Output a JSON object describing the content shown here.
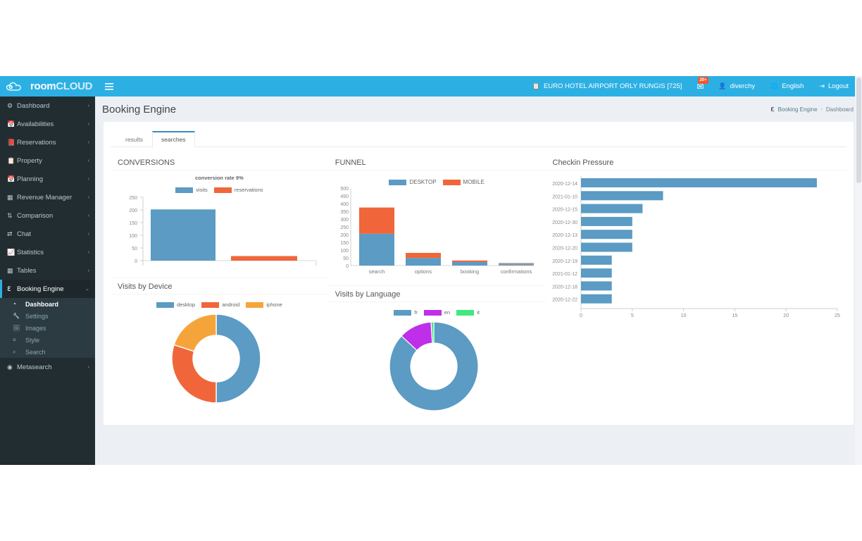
{
  "brand": {
    "room": "room",
    "cloud": "CLOUD",
    "logo_icon": "cloud-icon"
  },
  "topbar": {
    "hotel": "EURO HOTEL AIRPORT ORLY RUNGIS [725]",
    "hotel_icon": "clipboard-icon",
    "mail_icon": "envelope-icon",
    "mail_badge": "20+",
    "user": "diverchy",
    "user_icon": "user-icon",
    "language": "English",
    "language_icon": "globe-icon",
    "logout": "Logout",
    "logout_icon": "logout-icon",
    "bg_color": "#2cb0e4"
  },
  "sidebar": {
    "items": [
      {
        "label": "Dashboard",
        "icon": "gear-icon",
        "glyph": "⚙",
        "arrow": "‹"
      },
      {
        "label": "Availabilities",
        "icon": "calendar-icon",
        "glyph": "Ὄ5",
        "arrow": "‹"
      },
      {
        "label": "Reservations",
        "icon": "book-icon",
        "glyph": "▤",
        "arrow": "‹"
      },
      {
        "label": "Property",
        "icon": "clipboard-icon",
        "glyph": "ὌB",
        "arrow": "‹"
      },
      {
        "label": "Planning",
        "icon": "calendar-icon",
        "glyph": "Ὄ5",
        "arrow": "‹"
      },
      {
        "label": "Revenue Manager",
        "icon": "grid-icon",
        "glyph": "▦",
        "arrow": "‹"
      },
      {
        "label": "Comparison",
        "icon": "sort-icon",
        "glyph": "↓↑",
        "arrow": "‹"
      },
      {
        "label": "Chat",
        "icon": "exchange-icon",
        "glyph": "⇄",
        "arrow": "‹"
      },
      {
        "label": "Statistics",
        "icon": "chart-icon",
        "glyph": "ὌA",
        "arrow": "‹"
      },
      {
        "label": "Tables",
        "icon": "table-icon",
        "glyph": "▦",
        "arrow": "‹"
      },
      {
        "label": "Booking Engine",
        "icon": "booking-engine-icon",
        "glyph": "e",
        "arrow": "⌄",
        "active": true
      }
    ],
    "subitems": [
      {
        "label": "Dashboard",
        "icon": "dashboard-icon",
        "glyph": "◔",
        "active": true
      },
      {
        "label": "Settings",
        "icon": "wrench-icon",
        "glyph": "ὒ7",
        "active": false
      },
      {
        "label": "Images",
        "icon": "image-icon",
        "glyph": "ὛC",
        "active": false
      },
      {
        "label": "Style",
        "icon": "list-icon",
        "glyph": "≡",
        "active": false
      },
      {
        "label": "Search",
        "icon": "search-icon",
        "glyph": "⌕",
        "active": false
      }
    ],
    "footer_item": {
      "label": "Metasearch",
      "icon": "target-icon",
      "glyph": "◉",
      "arrow": "‹"
    },
    "bg_color": "#222d32"
  },
  "header": {
    "page_title": "Booking Engine",
    "breadcrumb_icon": "booking-engine-icon",
    "breadcrumb_root": "Booking Engine",
    "breadcrumb_sep": "›",
    "breadcrumb_current": "Dashboard"
  },
  "tabs": [
    {
      "label": "results",
      "active": false
    },
    {
      "label": "searches",
      "active": true
    }
  ],
  "colors": {
    "blue": "#5b9bc4",
    "orange": "#f0663a",
    "amber": "#f5a43a",
    "magenta": "#bf2ee8",
    "green": "#3ee97e",
    "gray": "#8c9aa5"
  },
  "chart_data": [
    {
      "id": "conversions",
      "type": "bar",
      "title": "CONVERSIONS",
      "subtitle": "conversion rate 9%",
      "categories": [
        "visits",
        "reservations"
      ],
      "values": [
        202,
        18
      ],
      "colors": [
        "#5b9bc4",
        "#f0663a"
      ],
      "legend": [
        "visits",
        "reservations"
      ],
      "legend_position": "top",
      "xlabel": "",
      "ylabel": "",
      "ylim": [
        0,
        250
      ],
      "yticks": [
        0,
        50,
        100,
        150,
        200,
        250
      ],
      "grid": false
    },
    {
      "id": "funnel",
      "type": "bar",
      "title": "FUNNEL",
      "subtitle": "",
      "stacked": true,
      "categories": [
        "search",
        "options",
        "booking",
        "confirmations"
      ],
      "series": [
        {
          "name": "DESKTOP",
          "values": [
            250,
            60,
            28,
            15
          ],
          "color": "#5b9bc4"
        },
        {
          "name": "MOBILE",
          "values": [
            210,
            40,
            12,
            0
          ],
          "color": "#f0663a"
        }
      ],
      "legend": [
        "DESKTOP",
        "MOBILE"
      ],
      "legend_position": "top",
      "xlabel": "",
      "ylabel": "",
      "ylim": [
        0,
        500
      ],
      "yticks": [
        0,
        50,
        100,
        150,
        200,
        250,
        300,
        350,
        400,
        450,
        500
      ],
      "grid": false,
      "note": "confirmations bar rendered in hover gray"
    },
    {
      "id": "checkin-pressure",
      "type": "bar",
      "orientation": "horizontal",
      "title": "Checkin Pressure",
      "categories": [
        "2020-12-14",
        "2021-01-10",
        "2020-12-15",
        "2020-12-30",
        "2020-12-13",
        "2020-12-20",
        "2020-12-19",
        "2021-01-12",
        "2020-12-18",
        "2020-12-22"
      ],
      "values": [
        23,
        8,
        6,
        5,
        5,
        5,
        3,
        3,
        3,
        3
      ],
      "color": "#5b9bc4",
      "xlabel": "",
      "ylabel": "",
      "xlim": [
        0,
        25
      ],
      "xticks": [
        0,
        5,
        10,
        15,
        20,
        25
      ],
      "grid": false
    },
    {
      "id": "visits-by-device",
      "type": "pie",
      "variant": "donut",
      "title": "Visits by Device",
      "labels": [
        "desktop",
        "android",
        "iphone"
      ],
      "values": [
        50,
        30,
        20
      ],
      "colors": [
        "#5b9bc4",
        "#f0663a",
        "#f5a43a"
      ],
      "legend": [
        "desktop",
        "android",
        "iphone"
      ],
      "legend_position": "top"
    },
    {
      "id": "visits-by-language",
      "type": "pie",
      "variant": "donut",
      "title": "Visits by Language",
      "labels": [
        "fr",
        "en",
        "it"
      ],
      "values": [
        87,
        12,
        1
      ],
      "colors": [
        "#5b9bc4",
        "#bf2ee8",
        "#3ee97e"
      ],
      "legend": [
        "fr",
        "en",
        "it"
      ],
      "legend_position": "top"
    }
  ]
}
